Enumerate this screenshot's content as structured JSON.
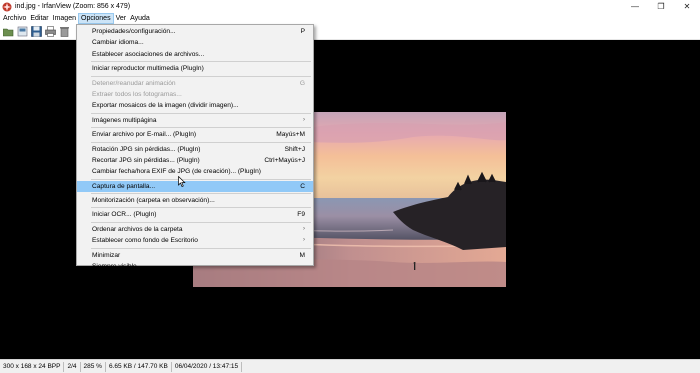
{
  "window": {
    "title": "ind.jpg - IrfanView (Zoom: 856 x 479)",
    "controls": {
      "minimize": "—",
      "maximize": "❐",
      "close": "✕"
    }
  },
  "menubar": {
    "items": [
      {
        "label": "Archivo"
      },
      {
        "label": "Editar"
      },
      {
        "label": "Imagen"
      },
      {
        "label": "Opciones"
      },
      {
        "label": "Ver"
      },
      {
        "label": "Ayuda"
      }
    ]
  },
  "toolbar": {
    "buttons": [
      "open-folder-icon",
      "thumbnails-icon",
      "save-icon",
      "print-icon",
      "delete-icon"
    ]
  },
  "options_menu": {
    "items": [
      {
        "label": "Propiedades/configuración...",
        "shortcut": "P"
      },
      {
        "label": "Cambiar idioma...",
        "shortcut": ""
      },
      {
        "label": "Establecer asociaciones de archivos...",
        "shortcut": ""
      },
      {
        "label": "Iniciar reproductor multimedia (PlugIn)",
        "shortcut": ""
      },
      {
        "label": "Detener/reanudar animación",
        "shortcut": "G"
      },
      {
        "label": "Extraer todos los fotogramas...",
        "shortcut": ""
      },
      {
        "label": "Exportar mosaicos de la imagen (dividir imagen)...",
        "shortcut": ""
      },
      {
        "label": "Imágenes multipágina",
        "shortcut": "›"
      },
      {
        "label": "Enviar archivo por E-mail... (PlugIn)",
        "shortcut": "Mayús+M"
      },
      {
        "label": "Rotación JPG sin pérdidas... (PlugIn)",
        "shortcut": "Shift+J"
      },
      {
        "label": "Recortar JPG sin pérdidas... (PlugIn)",
        "shortcut": "Ctrl+Mayús+J"
      },
      {
        "label": "Cambiar fecha/hora EXIF de JPG (de creación)... (PlugIn)",
        "shortcut": ""
      },
      {
        "label": "Captura de pantalla...",
        "shortcut": "C"
      },
      {
        "label": "Monitorización (carpeta en observación)...",
        "shortcut": ""
      },
      {
        "label": "Iniciar OCR... (PlugIn)",
        "shortcut": "F9"
      },
      {
        "label": "Ordenar archivos de la carpeta",
        "shortcut": "›"
      },
      {
        "label": "Establecer como fondo de Escritorio",
        "shortcut": "›"
      },
      {
        "label": "Minimizar",
        "shortcut": "M"
      },
      {
        "label": "Siempre visible",
        "shortcut": ""
      }
    ]
  },
  "statusbar": {
    "cells": [
      "300 x 168 x 24 BPP",
      "2/4",
      "285 %",
      "6.65 KB / 147.70 KB",
      "06/04/2020 / 13:47:15"
    ]
  },
  "colors": {
    "menu_highlight": "#91c9f7",
    "active_menu": "#cce4f7",
    "canvas": "#000000"
  }
}
